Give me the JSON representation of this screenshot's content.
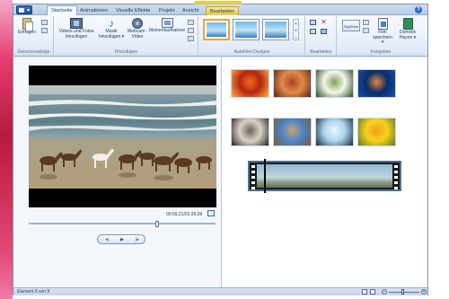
{
  "app": {
    "menu_label": "▾"
  },
  "tabs": [
    {
      "label": "Startseite",
      "active": true
    },
    {
      "label": "Animationen"
    },
    {
      "label": "Visuelle Effekte"
    },
    {
      "label": "Projekt"
    },
    {
      "label": "Ansicht"
    },
    {
      "label": "Bearbeiten",
      "contextual": true
    }
  ],
  "ribbon": {
    "clipboard": {
      "paste_label": "Einfügen",
      "group_label": "Zwischenablage"
    },
    "add": {
      "videos_photos_label": "Videos und Fotos hinzufügen",
      "music_label": "Musik hinzufügen ▾",
      "webcam_label": "Webcam -Video",
      "snapshot_label": "Momentaufnahme",
      "group_label": "Hinzufügen"
    },
    "automovie": {
      "group_label": "AutoFilm-Designs"
    },
    "edit": {
      "group_label": "Bearbeiten"
    },
    "share": {
      "skydrive_label": "SkyDrive",
      "save_movie_label": "Film speichern ▾",
      "user_label": "Dominik Hayon ▾",
      "group_label": "Freigeben"
    }
  },
  "preview": {
    "timecode": "00:59,21/01:26,09",
    "seek_fraction": 0.69
  },
  "transport": {
    "prev_label": "◂|",
    "play_label": "▶",
    "next_label": "|▸"
  },
  "storyboard": {
    "thumbnails": [
      {
        "name": "chrysanthemum",
        "colors": [
          "#b3260f",
          "#f06a1c",
          "#ffb347"
        ]
      },
      {
        "name": "desert",
        "colors": [
          "#e28a4a",
          "#a8452a",
          "#5a2414"
        ]
      },
      {
        "name": "hydrangeas",
        "colors": [
          "#f4f7ec",
          "#7fa35a",
          "#2e4a1e"
        ]
      },
      {
        "name": "jellyfish",
        "colors": [
          "#0b2d6a",
          "#e2883a",
          "#1b4ea8"
        ]
      },
      {
        "name": "koala",
        "colors": [
          "#d9d2c6",
          "#6e655c",
          "#2b251f"
        ]
      },
      {
        "name": "lighthouse",
        "colors": [
          "#4c86c9",
          "#c9a26f",
          "#7a5a38"
        ]
      },
      {
        "name": "penguins",
        "colors": [
          "#a9d6f0",
          "#f2f5f8",
          "#1d2c3c"
        ]
      },
      {
        "name": "tulips",
        "colors": [
          "#f7d21c",
          "#f0a01a",
          "#5e7a2a"
        ]
      }
    ],
    "playhead_fraction": 0.1
  },
  "status": {
    "text": "Element 9 von 9",
    "zoom_fraction": 0.45,
    "zoom_out": "−",
    "zoom_in": "+"
  },
  "colors": {
    "accent": "#2d6bc6",
    "ribbon_bg": "#e6eef9",
    "contextual_tab": "#e7c94d",
    "desktop_strip": "#cf2f55"
  }
}
